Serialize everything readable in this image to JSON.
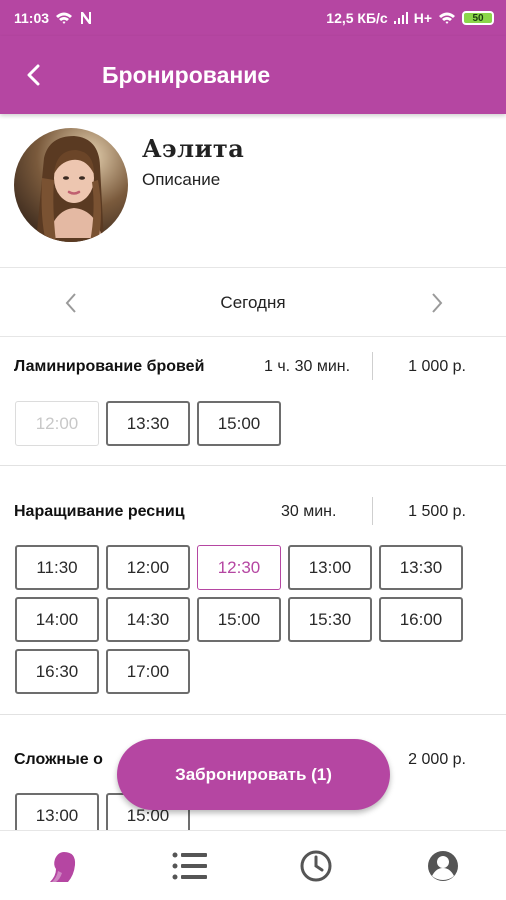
{
  "statusbar": {
    "time": "11:03",
    "network_speed": "12,5 КБ/с",
    "network_type": "H+",
    "battery": "50"
  },
  "appbar": {
    "title": "Бронирование"
  },
  "profile": {
    "name": "Аэлита",
    "description": "Описание"
  },
  "date_nav": {
    "label": "Сегодня"
  },
  "services": [
    {
      "name": "Ламинирование бровей",
      "duration": "1 ч. 30 мин.",
      "price": "1 000 р.",
      "slots": [
        {
          "time": "12:00",
          "state": "disabled"
        },
        {
          "time": "13:30",
          "state": "available"
        },
        {
          "time": "15:00",
          "state": "available"
        }
      ]
    },
    {
      "name": "Наращивание ресниц",
      "duration": "30 мин.",
      "price": "1 500 р.",
      "slots": [
        {
          "time": "11:30",
          "state": "available"
        },
        {
          "time": "12:00",
          "state": "available"
        },
        {
          "time": "12:30",
          "state": "selected"
        },
        {
          "time": "13:00",
          "state": "available"
        },
        {
          "time": "13:30",
          "state": "available"
        },
        {
          "time": "14:00",
          "state": "available"
        },
        {
          "time": "14:30",
          "state": "available"
        },
        {
          "time": "15:00",
          "state": "available"
        },
        {
          "time": "15:30",
          "state": "available"
        },
        {
          "time": "16:00",
          "state": "available"
        },
        {
          "time": "16:30",
          "state": "available"
        },
        {
          "time": "17:00",
          "state": "available"
        }
      ]
    },
    {
      "name": "Сложные о",
      "duration": "",
      "price": "2 000 р.",
      "slots": [
        {
          "time": "13:00",
          "state": "available"
        },
        {
          "time": "15:00",
          "state": "available"
        }
      ]
    }
  ],
  "book_button": {
    "label": "Забронировать (1)"
  },
  "bottom_nav": {
    "items": [
      {
        "icon": "master-profile-icon",
        "active": true
      },
      {
        "icon": "list-icon",
        "active": false
      },
      {
        "icon": "clock-icon",
        "active": false
      },
      {
        "icon": "account-icon",
        "active": false
      }
    ]
  },
  "colors": {
    "accent": "#b546a2",
    "slot_border": "#6d6d6d",
    "slot_disabled": "#dcdcdc",
    "icon_inactive": "#555555"
  }
}
